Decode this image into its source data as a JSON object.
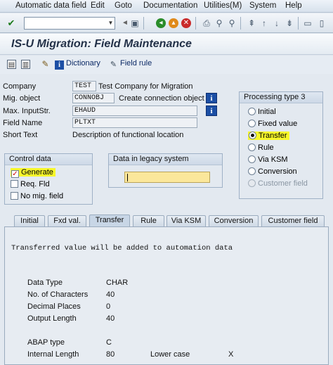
{
  "menu": {
    "items": [
      "Automatic data field",
      "Edit",
      "Goto",
      "Documentation",
      "Utilities(M)",
      "System",
      "Help"
    ]
  },
  "toolbar": {
    "command_value": ""
  },
  "title": "IS-U Migration: Field Maintenance",
  "app_toolbar": {
    "dictionary_label": "Dictionary",
    "field_rule_label": "Field rule"
  },
  "form": {
    "company_label": "Company",
    "company_value": "TEST",
    "company_desc": "Test Company for Migration",
    "mig_object_label": "Mig. object",
    "mig_object_value": "CONNOBJ",
    "mig_object_desc": "Create connection object",
    "max_input_label": "Max. InputStr.",
    "max_input_value": "EHAUD",
    "field_name_label": "Field Name",
    "field_name_value": "PLTXT",
    "short_text_label": "Short Text",
    "short_text_value": "Description of functional location"
  },
  "processing_type": {
    "title": "Processing type 3",
    "options": [
      "Initial",
      "Fixed value",
      "Transfer",
      "Rule",
      "Via KSM",
      "Conversion",
      "Customer field"
    ],
    "selected": "Transfer"
  },
  "control_data": {
    "title": "Control data",
    "generate_label": "Generate",
    "req_fld_label": "Req. Fld",
    "no_mig_field_label": "No mig. field"
  },
  "legacy": {
    "title": "Data in legacy system",
    "value": ""
  },
  "tabs": [
    "Initial",
    "Fxd val.",
    "Transfer",
    "Rule",
    "Via KSM",
    "Conversion",
    "Customer field"
  ],
  "active_tab": "Transfer",
  "transfer_tab": {
    "message": "Transferred value will be added to automation data",
    "data_type_label": "Data Type",
    "data_type_value": "CHAR",
    "num_chars_label": "No. of Characters",
    "num_chars_value": "40",
    "decimals_label": "Decimal Places",
    "decimals_value": "0",
    "output_length_label": "Output Length",
    "output_length_value": "40",
    "abap_type_label": "ABAP type",
    "abap_type_value": "C",
    "internal_length_label": "Internal Length",
    "internal_length_value": "80",
    "lower_case_label": "Lower case",
    "lower_case_value": "X"
  },
  "colors": {
    "highlight": "#f7f72a",
    "info_button": "#1c4fa5",
    "legacy_input": "#fbe79b"
  }
}
